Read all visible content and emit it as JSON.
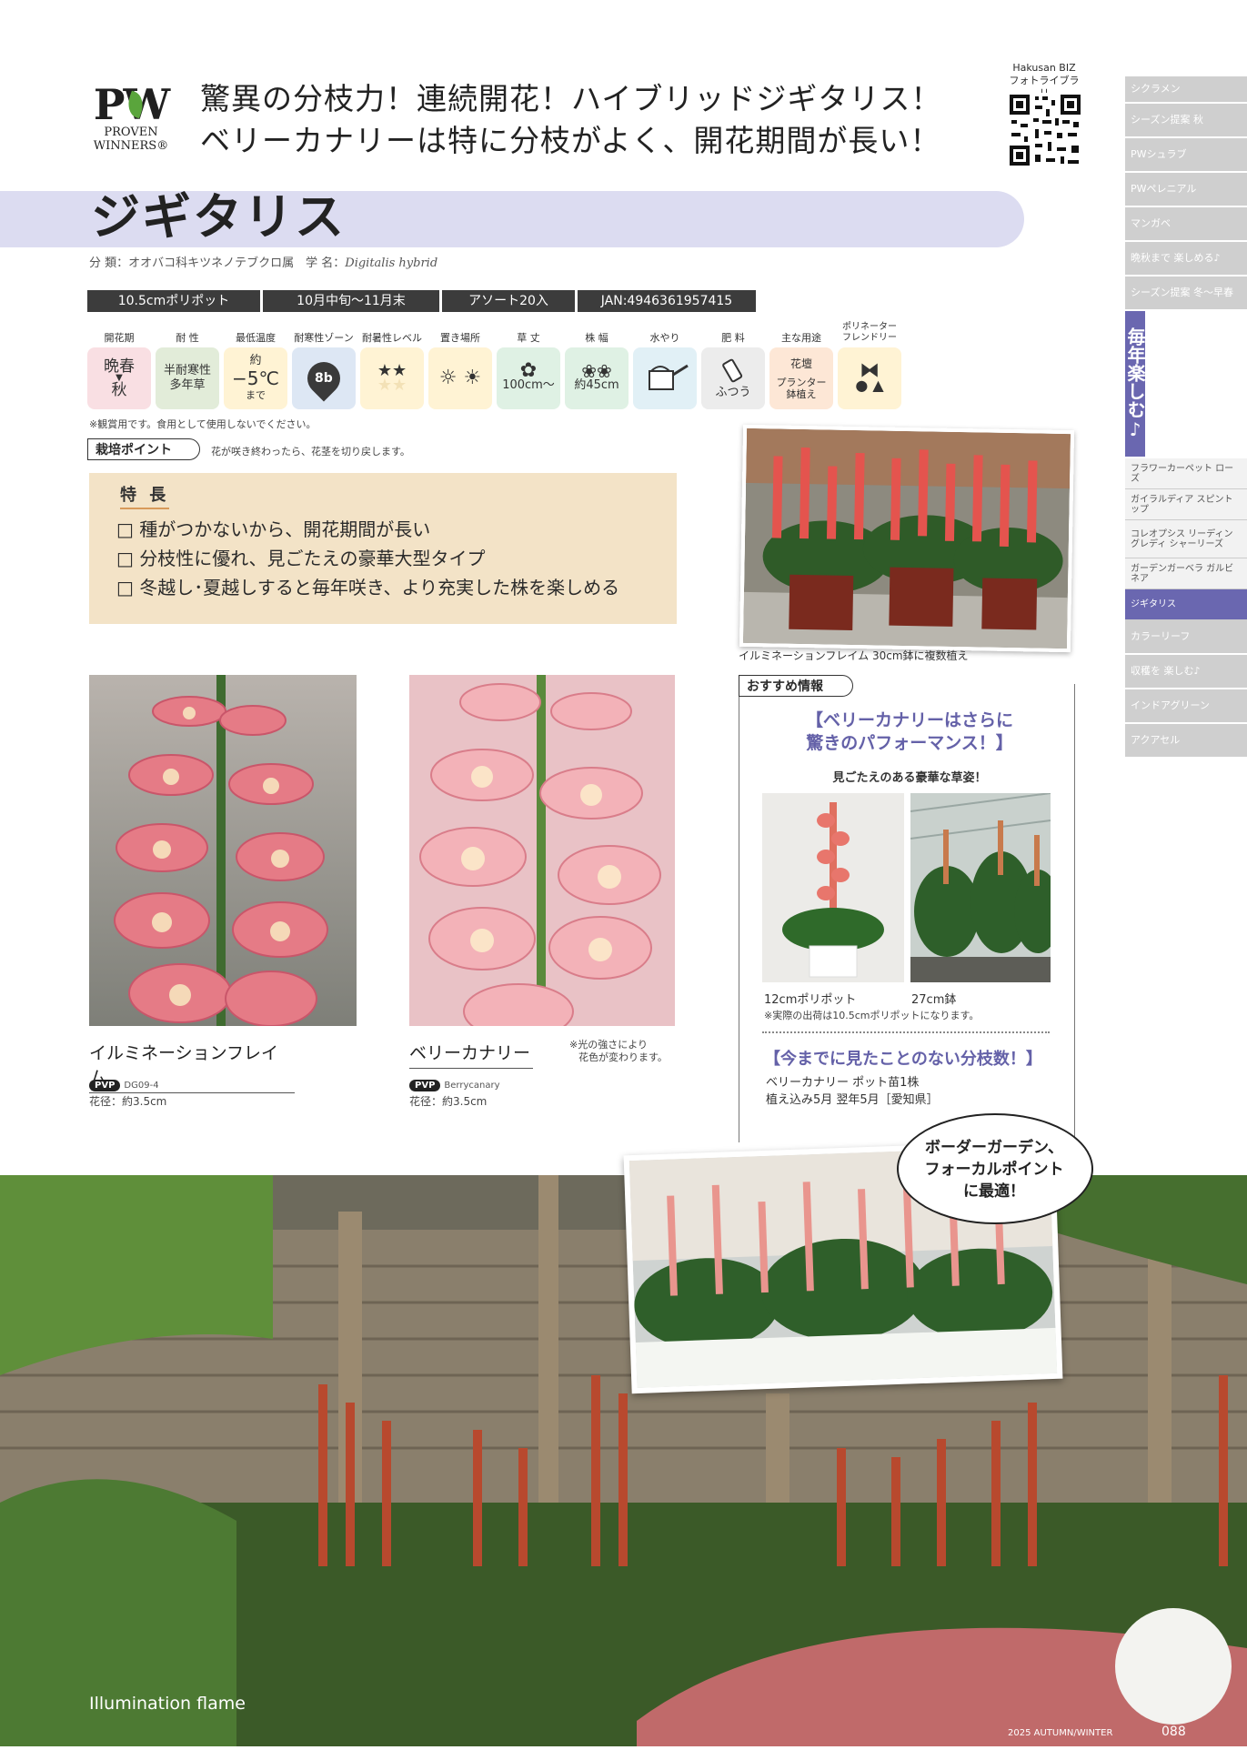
{
  "brand": {
    "logo": "PW",
    "line1": "PROVEN",
    "line2": "WINNERS®"
  },
  "headline": {
    "line1": "驚異の分枝力！連続開花！ハイブリッドジギタリス！",
    "line2": "ベリーカナリーは特に分枝がよく、開花期間が長い！"
  },
  "qr": {
    "label1": "Hakusan BIZ",
    "label2": "フォトライブラリ"
  },
  "title": "ジギタリス",
  "classification": {
    "prefix": "分 類：オオバコ科キツネノテブクロ属　学 名：",
    "scientific": "Digitalis hybrid"
  },
  "info_bar": [
    "10.5cmポリポット",
    "10月中旬～11月末",
    "アソート20入",
    "JAN:4946361957415"
  ],
  "attributes": {
    "flowering_label": "開花期",
    "flowering_v1": "晩春",
    "flowering_v2": "秋",
    "hardiness_label": "耐 性",
    "hardiness_v1": "半耐寒性",
    "hardiness_v2": "多年草",
    "mintemp_label": "最低温度",
    "mintemp_v1": "約",
    "mintemp_v2": "−5℃",
    "mintemp_v3": "まで",
    "zone_label": "耐寒性ゾーン",
    "zone_value": "8b",
    "heat_label": "耐暑性レベル",
    "heat_value": "★★",
    "place_label": "置き場所",
    "height_label": "草 丈",
    "height_value": "100cm～",
    "width_label": "株 幅",
    "width_value": "約45cm",
    "water_label": "水やり",
    "fert_label": "肥 料",
    "fert_value": "ふつう",
    "use_label": "主な用途",
    "use_v1": "花壇",
    "use_v2": "プランター",
    "use_v3": "鉢植え",
    "poll_label1": "ポリネーター",
    "poll_label2": "フレンドリー"
  },
  "note": "※観賞用です。食用として使用しないでください。",
  "tip": {
    "label": "栽培ポイント",
    "text": "花が咲き終わったら、花茎を切り戻します。"
  },
  "features": {
    "title": "特 長",
    "items": [
      "種がつかないから、開花期間が長い",
      "分枝性に優れ、見ごたえの豪華大型タイプ",
      "冬越し･夏越しすると毎年咲き、より充実した株を楽しめる"
    ]
  },
  "varieties": [
    {
      "name": "イルミネーションフレイム",
      "pvp": "PVP",
      "code": "DG09-4",
      "diameter": "花径：約3.5cm"
    },
    {
      "name": "ベリーカナリー",
      "pvp": "PVP",
      "code": "Berrycanary",
      "diameter": "花径：約3.5cm"
    }
  ],
  "light_note": {
    "line1": "※光の強さにより",
    "line2": "花色が変わります。"
  },
  "photo_caption": "イルミネーションフレイム 30cm鉢に複数植え",
  "recommend": {
    "tab": "おすすめ情報",
    "headline1": "【ベリーカナリーはさらに",
    "headline2": "驚きのパフォーマンス！】",
    "sub": "見ごたえのある豪華な草姿！",
    "cap1": "12cmポリポット",
    "cap2": "27cm鉢",
    "cap_note": "※実際の出荷は10.5cmポリポットになります。",
    "headline3": "【今までに見たことのない分枝数！】",
    "text1": "ベリーカナリー ポット苗1株",
    "text2": "植え込み5月 翌年5月［愛知県］"
  },
  "sidenav": {
    "items": [
      "シクラメン",
      "シーズン提案 秋",
      "PWシュラブ",
      "PWペレニアル",
      "マンガベ",
      "晩秋まで 楽しめる♪",
      "シーズン提案 冬～早春"
    ],
    "active": "毎年楽しむ♪",
    "subitems": [
      "フラワーカーペット ローズ",
      "ガイラルディア スピントップ",
      "コレオプシス リーディングレディ シャーリーズ",
      "ガーデンガーベラ ガルビネア",
      "ジギタリス"
    ],
    "after": [
      "カラーリーフ",
      "収穫を 楽しむ♪",
      "インドアグリーン",
      "アクアセル"
    ]
  },
  "bubble": {
    "line1": "ボーダーガーデン、",
    "line2": "フォーカルポイント",
    "line3": "に最適！"
  },
  "garden_label": "Illumination flame",
  "footer": {
    "year": "2025 AUTUMN/WINTER",
    "page": "088"
  },
  "colors": {
    "accent_purple": "#6a67b0",
    "title_band": "#dcdcf1",
    "features_bg": "#f3e3c7"
  },
  "icons": [
    "leaf-icon",
    "qr-code-icon",
    "map-pin-icon",
    "sun-icon",
    "flower-height-icon",
    "flower-width-icon",
    "watering-can-icon",
    "fertilizer-icon",
    "butterfly-icon",
    "bee-icon",
    "bird-icon"
  ]
}
